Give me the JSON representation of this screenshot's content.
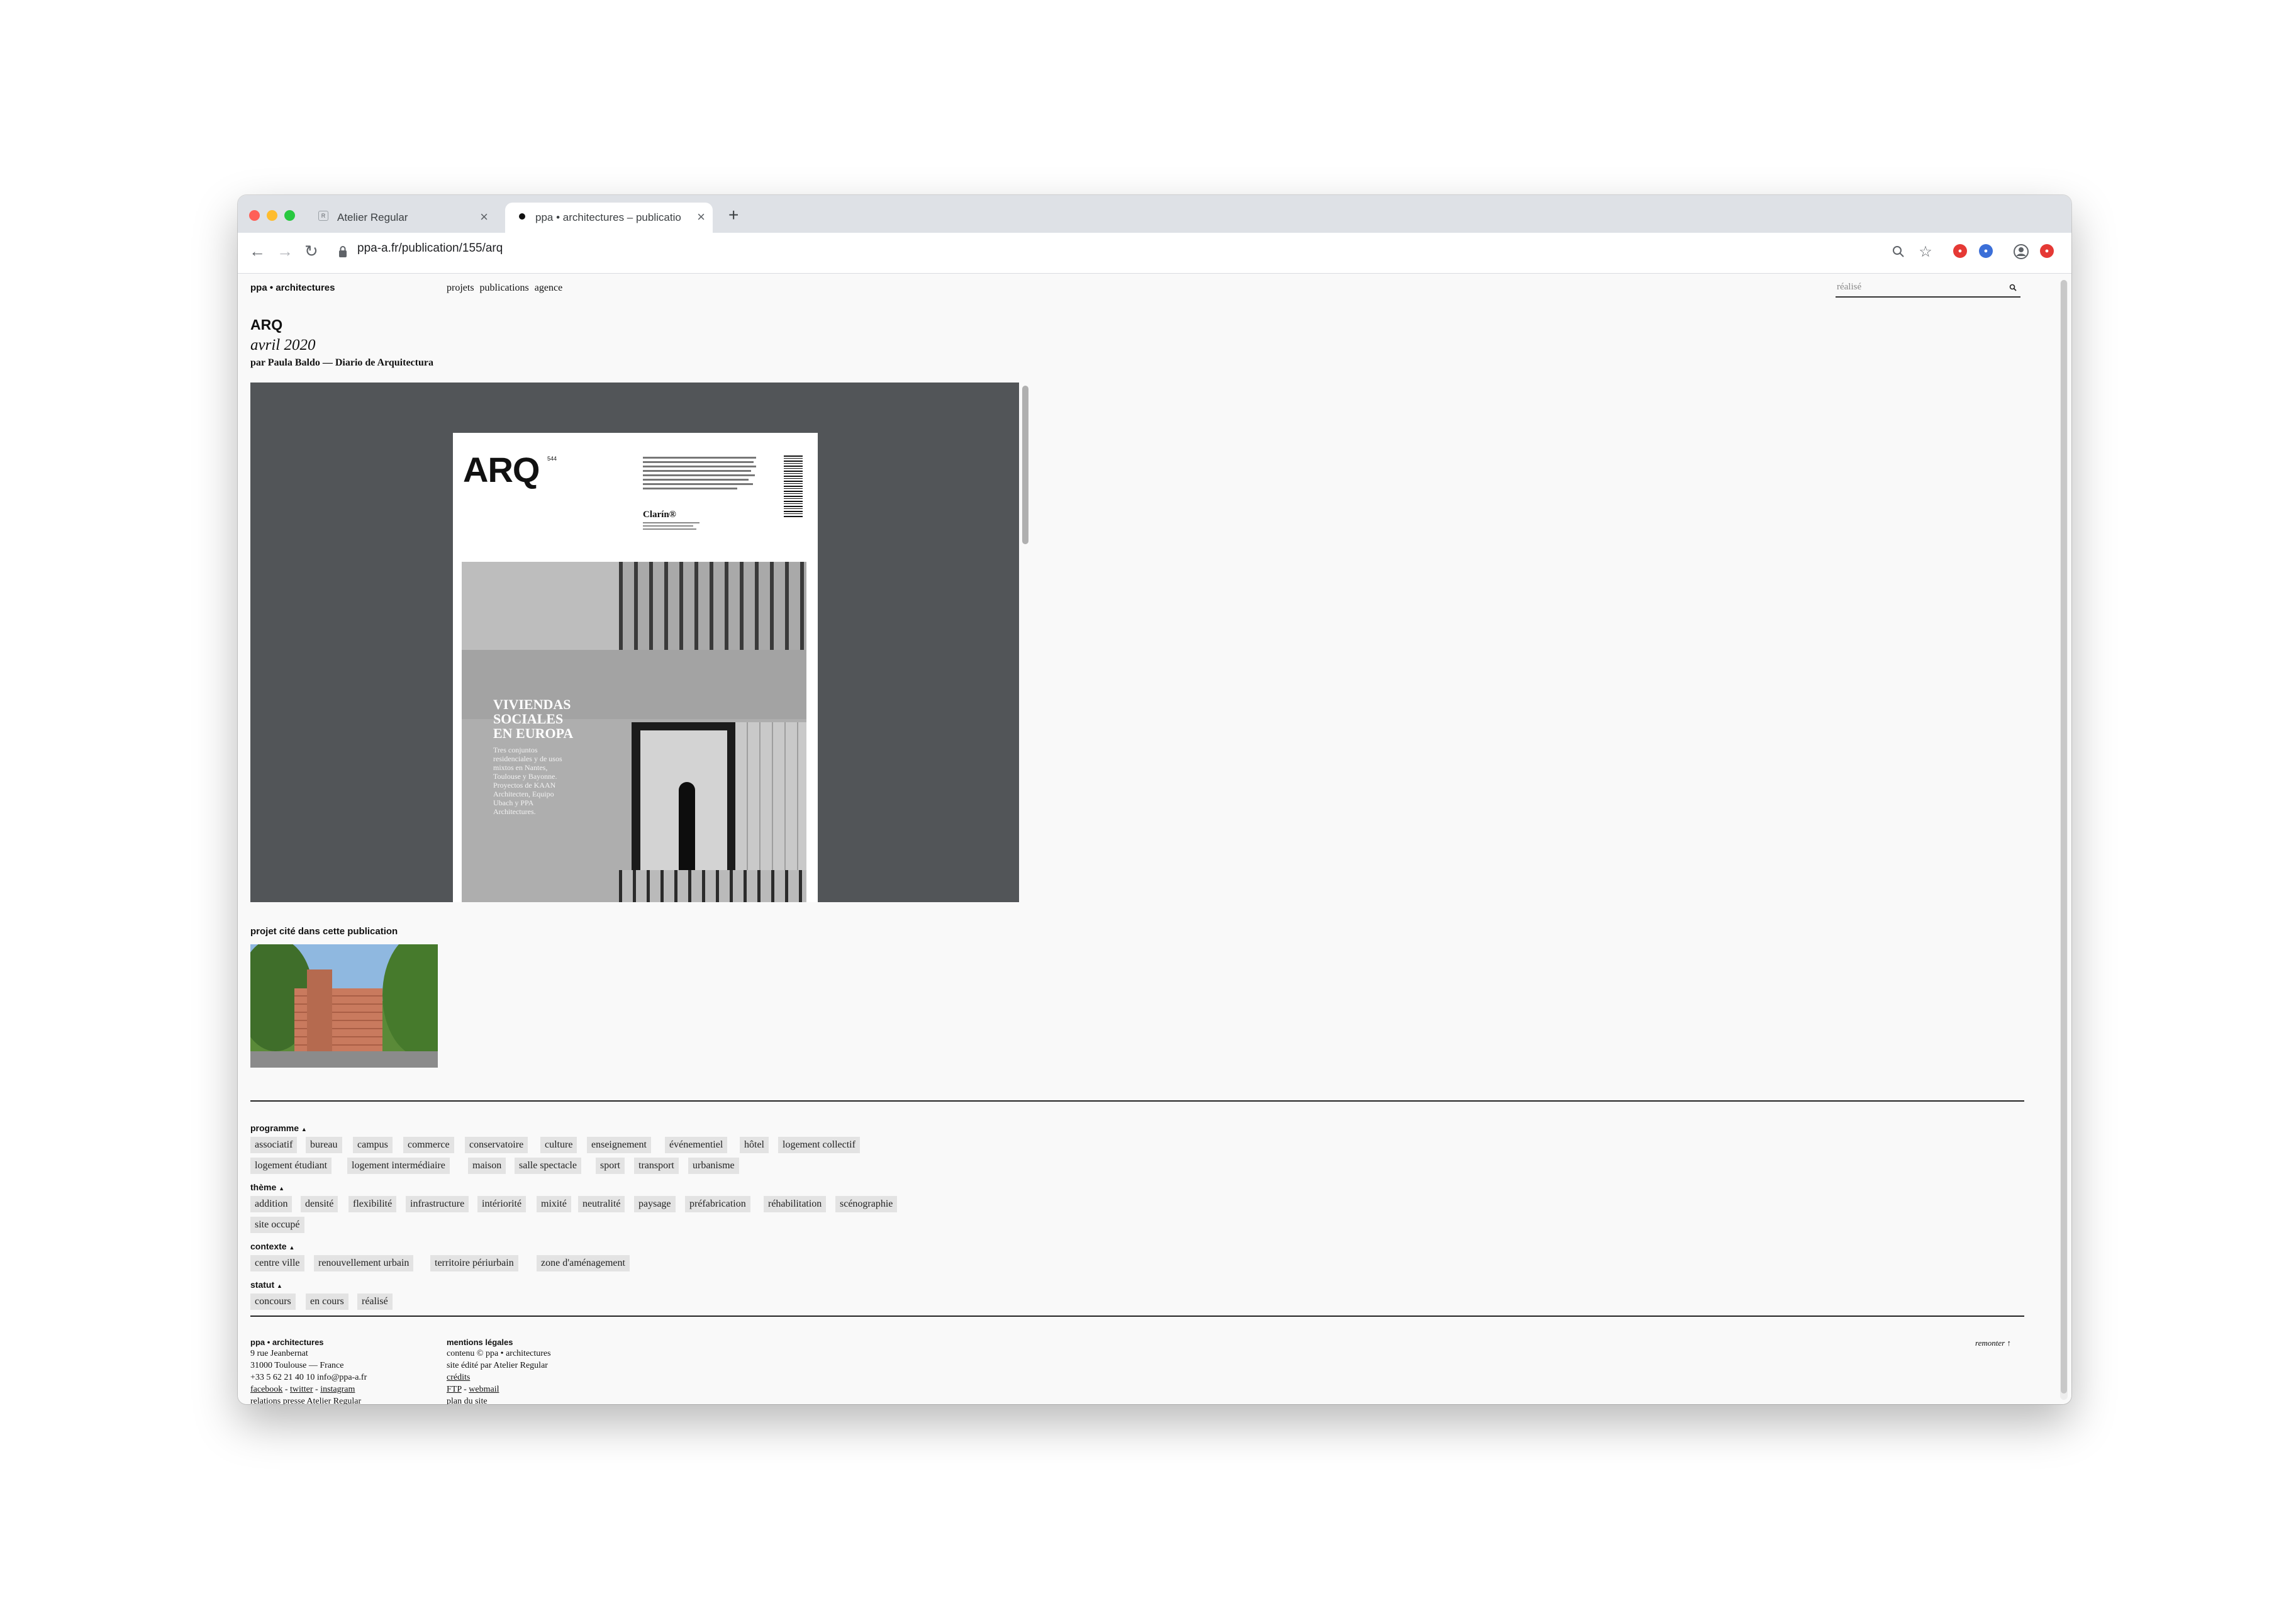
{
  "browser": {
    "tabs": [
      {
        "title": "Atelier Regular",
        "active": false
      },
      {
        "title": "ppa • architectures – publicatio",
        "active": true
      }
    ],
    "new_tab_symbol": "+",
    "url": "ppa-a.fr/publication/155/arq"
  },
  "site": {
    "logo": "ppa • architectures",
    "nav": [
      "projets",
      "publications",
      "agence"
    ],
    "search_placeholder": "réalisé"
  },
  "publication": {
    "title": "ARQ",
    "date": "avril 2020",
    "byline": "par Paula Baldo — Diario de Arquitectura"
  },
  "cover": {
    "logo": "ARQ",
    "issue_sup": "544",
    "brand": "Clarín®",
    "headline": [
      "VIVIENDAS",
      "SOCIALES",
      "EN EUROPA"
    ],
    "subtext": [
      "Tres conjuntos",
      "residenciales y de usos",
      "mixtos en Nantes,",
      "Toulouse y Bayonne.",
      "Proyectos de KAAN",
      "Architecten, Equipo",
      "Ubach y PPA",
      "Architectures."
    ]
  },
  "related": {
    "label": "projet cité dans cette publication"
  },
  "filters": {
    "programme": {
      "label": "programme",
      "tags": [
        "associatif",
        "bureau",
        "campus",
        "commerce",
        "conservatoire",
        "culture",
        "enseignement",
        "événementiel",
        "hôtel",
        "logement collectif",
        "logement étudiant",
        "logement intermédiaire",
        "maison",
        "salle spectacle",
        "sport",
        "transport",
        "urbanisme"
      ]
    },
    "theme": {
      "label": "thème",
      "tags": [
        "addition",
        "densité",
        "flexibilité",
        "infrastructure",
        "intériorité",
        "mixité",
        "neutralité",
        "paysage",
        "préfabrication",
        "réhabilitation",
        "scénographie",
        "site occupé"
      ]
    },
    "contexte": {
      "label": "contexte",
      "tags": [
        "centre ville",
        "renouvellement urbain",
        "territoire périurbain",
        "zone d'aménagement"
      ]
    },
    "statut": {
      "label": "statut",
      "tags": [
        "concours",
        "en cours",
        "réalisé"
      ]
    }
  },
  "footer": {
    "col1": {
      "title": "ppa • architectures",
      "address1": "9 rue Jeanbernat",
      "address2": "31000 Toulouse — France",
      "phone_email": "+33 5 62 21 40 10 info@ppa-a.fr",
      "social": [
        "facebook",
        "twitter",
        "instagram"
      ],
      "last": "relations presse Atelier Regular"
    },
    "col2": {
      "title": "mentions légales",
      "line1": "contenu © ppa • architectures",
      "line2": "site édité par Atelier Regular",
      "credits": "crédits",
      "links": [
        "FTP",
        "webmail"
      ],
      "last": "plan du site"
    },
    "back_to_top": "remonter"
  }
}
